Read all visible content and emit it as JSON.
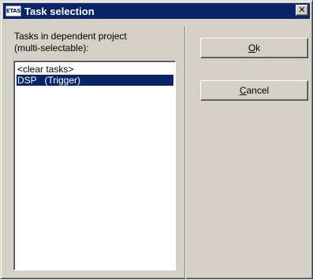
{
  "window": {
    "title": "Task selection",
    "app_icon_text": "ETAS",
    "close_glyph": "✕"
  },
  "tasks_label": {
    "line1": "Tasks in dependent project",
    "line2": "(multi-selectable):"
  },
  "task_list": {
    "items": [
      {
        "label": "<clear tasks>",
        "selected": false
      },
      {
        "label": "DSP   (Trigger)",
        "selected": true
      }
    ]
  },
  "buttons": {
    "ok": {
      "mnemonic": "O",
      "rest": "k"
    },
    "cancel": {
      "mnemonic": "C",
      "rest": "ancel"
    }
  },
  "colors": {
    "titlebar": "#0a246a",
    "selection": "#0a246a",
    "face": "#d4d0c8"
  }
}
